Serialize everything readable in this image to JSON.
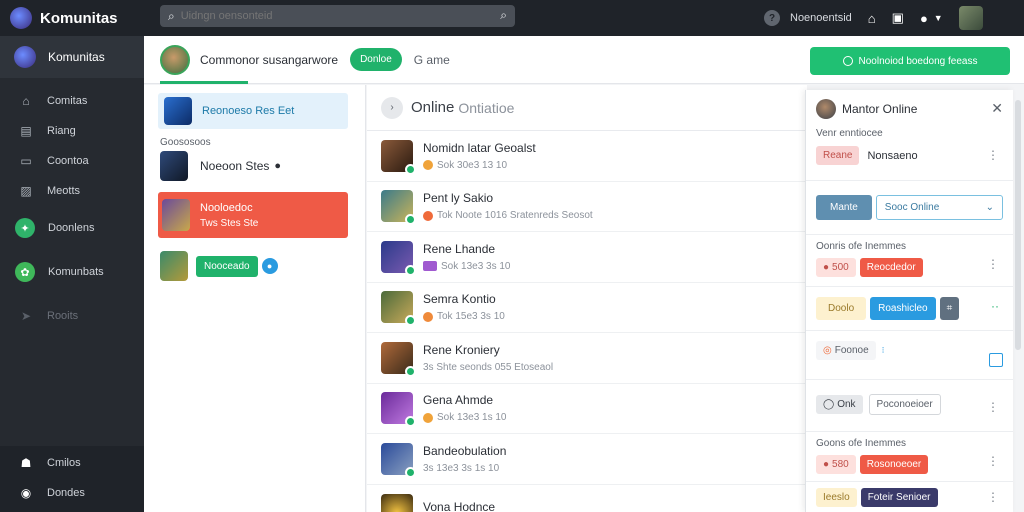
{
  "app": {
    "name": "Komunitas"
  },
  "search": {
    "placeholder": "Uidngn oensonteid"
  },
  "topbar": {
    "status_text": "Noenoentsid",
    "help": "?"
  },
  "sidebar": {
    "title": "Komunitas",
    "items": [
      {
        "label": "Comitas"
      },
      {
        "label": "Riang"
      },
      {
        "label": "Coontoa"
      },
      {
        "label": "Meotts"
      },
      {
        "label": "Doonlens"
      },
      {
        "label": "Komunbats"
      },
      {
        "label": "Rooits"
      }
    ],
    "bottom": [
      {
        "label": "Cmilos"
      },
      {
        "label": "Dondes"
      }
    ]
  },
  "header": {
    "title": "Commonor susangarwore",
    "pill": "Donloe",
    "game": "G ame",
    "cta": "Noolnoiod boedong feeass"
  },
  "leftpanel": {
    "card1": "Reonoeso Res Eet",
    "caption": "Goososoos",
    "row2": "Noeoon Stes",
    "red_title": "Nooloedoc",
    "red_sub": "Tws Stes Ste",
    "row4_pill": "Nooceado"
  },
  "center": {
    "title": "Online",
    "title2": "Ontiatioe",
    "rows": [
      {
        "name": "Nomidn latar Geoalst",
        "meta": "Sok  30e3 13 10"
      },
      {
        "name": "Pent ly Sakio",
        "meta": "Tok  Noote 1016 Sratenreds Seosot"
      },
      {
        "name": "Rene Lhande",
        "meta": "Sok  13e3 3s 10"
      },
      {
        "name": "Semra Kontio",
        "meta": "Tok  15e3 3s 10"
      },
      {
        "name": "Rene Kroniery",
        "meta": "3s Shte seonds 055 Etoseaol"
      },
      {
        "name": "Gena Ahmde",
        "meta": "Sok  13e3 1s 10"
      },
      {
        "name": "Bandeobulation",
        "meta": "3s  13e3 3s 1s 10"
      },
      {
        "name": "Vona Hodnce",
        "meta": ""
      }
    ]
  },
  "rightpanel": {
    "title": "Mantor Online",
    "s1_label": "Venr enntiocee",
    "s1_chip": "Reane",
    "s1_value": "Nonsaeno",
    "s2_btn": "Mante",
    "s2_select": "Sooc Online",
    "s3_label": "Oonris ofe Inemmes",
    "s3_chip1": "500",
    "s3_chip2": "Reocdedor",
    "s4_chip1": "Doolo",
    "s4_chip2": "Roashicleo",
    "s5_chip": "Foonoe",
    "s6_chip1": "Onk",
    "s6_chip2": "Poconoeioer",
    "s7_label": "Goons ofe Inemmes",
    "s7_chip1": "580",
    "s7_chip2": "Rosonoeoer",
    "s8_chip1": "Ieeslo",
    "s8_chip2": "Foteir Senioer"
  },
  "colors": {
    "accent_green": "#20b26b",
    "alert_red": "#ef5a46",
    "sidebar_bg": "#262a30",
    "topbar_bg": "#1f2329"
  }
}
